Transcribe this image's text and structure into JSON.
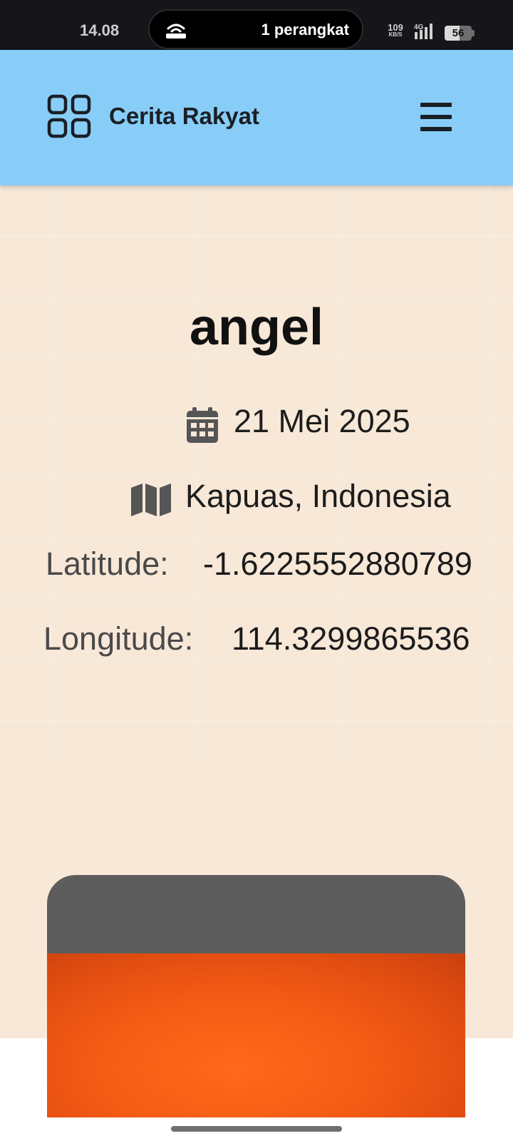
{
  "status_bar": {
    "time": "14.08",
    "hotspot_label": "1 perangkat",
    "net_speed": "109",
    "net_speed_unit": "KB/S",
    "network_type": "4G",
    "battery_level": "56",
    "battery_fraction": 0.56,
    "hotspot_icon": "hotspot-icon",
    "signal_icon": "signal-icon"
  },
  "header": {
    "brand": "Cerita Rakyat",
    "logo_icon": "grid-icon",
    "menu_icon": "hamburger-icon",
    "background_color": "#87cdf8"
  },
  "story": {
    "title": "angel",
    "date": "21 Mei 2025",
    "location": "Kapuas, Indonesia",
    "latitude_label": "Latitude:",
    "latitude_value": "-1.6225552880789",
    "longitude_label": "Longitude:",
    "longitude_value": "114.3299865536",
    "date_icon": "calendar-icon",
    "location_icon": "map-icon",
    "background_color": "#f8e8d8"
  },
  "media": {
    "image_color": "#f45a14",
    "frame_color": "#5d5d5d"
  }
}
